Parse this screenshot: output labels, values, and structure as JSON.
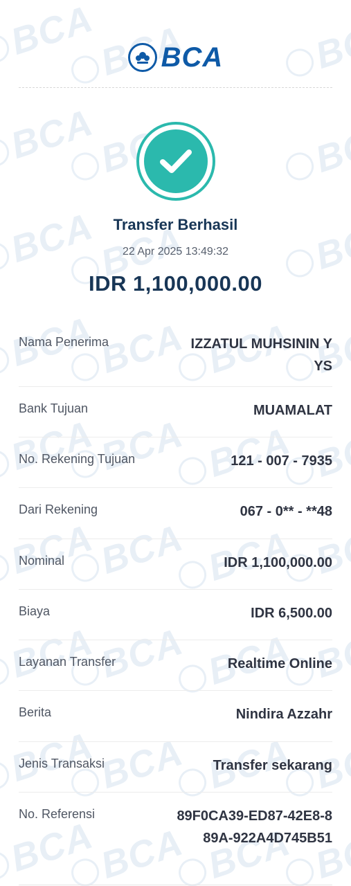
{
  "brand": {
    "logo_text": "BCA",
    "logo_icon": "bca-logo-icon",
    "watermark_text": "BCA",
    "primary_color": "#0e5aa7"
  },
  "status": {
    "icon": "check-circle-icon",
    "icon_color": "#2bb9ad",
    "title": "Transfer Berhasil",
    "datetime": "22 Apr 2025 13:49:32",
    "amount": "IDR 1,100,000.00"
  },
  "details": [
    {
      "label": "Nama Penerima",
      "value": "IZZATUL MUHSININ YYS"
    },
    {
      "label": "Bank Tujuan",
      "value": "MUAMALAT"
    },
    {
      "label": "No. Rekening Tujuan",
      "value": "121 - 007 - 7935"
    },
    {
      "label": "Dari Rekening",
      "value": "067 - 0** - **48"
    },
    {
      "label": "Nominal",
      "value": "IDR 1,100,000.00"
    },
    {
      "label": "Biaya",
      "value": "IDR 6,500.00"
    },
    {
      "label": "Layanan Transfer",
      "value": "Realtime Online"
    },
    {
      "label": "Berita",
      "value": "Nindira Azzahr"
    },
    {
      "label": "Jenis Transaksi",
      "value": "Transfer sekarang"
    },
    {
      "label": "No. Referensi",
      "value": "89F0CA39-ED87-42E8-889A-922A4D745B51"
    }
  ]
}
